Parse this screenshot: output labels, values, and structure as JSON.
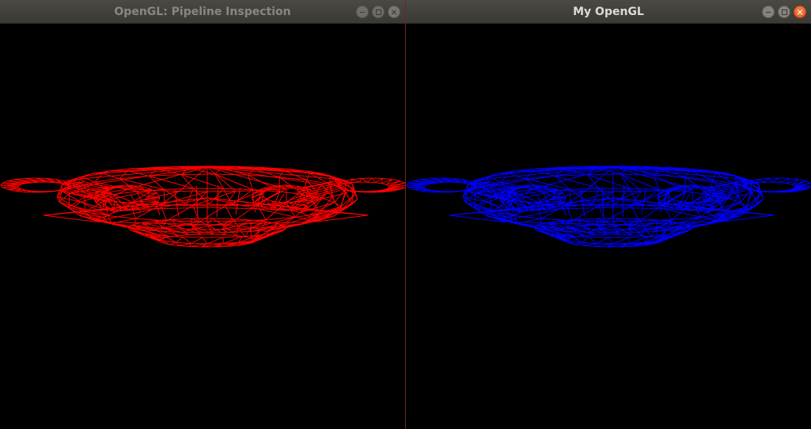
{
  "windows": [
    {
      "title": "OpenGL: Pipeline Inspection",
      "focused": false,
      "wire_color": "#ff0000",
      "buttons": [
        "minimize-icon",
        "maximize-icon",
        "close-icon"
      ]
    },
    {
      "title": "My OpenGL",
      "focused": true,
      "wire_color": "#0000ff",
      "buttons": [
        "minimize-icon",
        "maximize-icon",
        "close-icon"
      ]
    }
  ],
  "colors": {
    "titlebar": "#3f3e3a",
    "close_active": "#e95420",
    "background": "#000000"
  }
}
